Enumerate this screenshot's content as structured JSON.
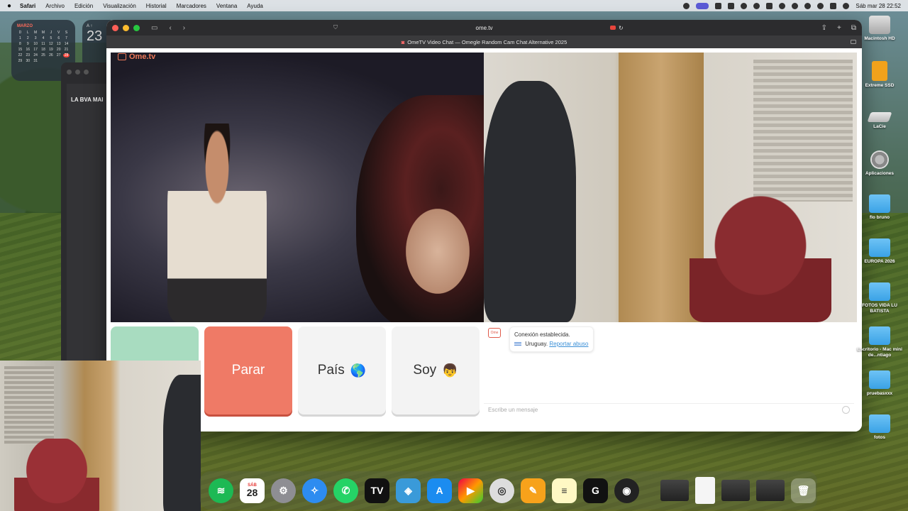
{
  "menubar": {
    "app": "Safari",
    "items": [
      "Archivo",
      "Edición",
      "Visualización",
      "Historial",
      "Marcadores",
      "Ventana",
      "Ayuda"
    ],
    "clock": "Sáb mar 28  22:52"
  },
  "calendar_widget": {
    "month": "MARZO",
    "weekdays": [
      "D",
      "L",
      "M",
      "M",
      "J",
      "V",
      "S"
    ],
    "days": [
      "1",
      "2",
      "3",
      "4",
      "5",
      "6",
      "7",
      "8",
      "9",
      "10",
      "11",
      "12",
      "13",
      "14",
      "15",
      "16",
      "17",
      "18",
      "19",
      "20",
      "21",
      "22",
      "23",
      "24",
      "25",
      "26",
      "27",
      "28",
      "29",
      "30",
      "31"
    ],
    "today": "28"
  },
  "clock_widget": {
    "top": "A ↑",
    "value": "23"
  },
  "bg_window": {
    "label": "LA BVA MAI"
  },
  "safari": {
    "url": "ome.tv",
    "tab_title": "OmeTV Video Chat — Omegle Random Cam Chat Alternative 2025"
  },
  "ometv": {
    "logo": "Ome.tv",
    "buttons": {
      "start": "",
      "stop": "Parar",
      "country": "País",
      "country_emoji": "🌎",
      "iam": "Soy",
      "iam_emoji": "👦"
    },
    "chat": {
      "status": "Conexión establecida.",
      "country": "Uruguay.",
      "report": "Reportar abuso",
      "placeholder": "Escribe un mensaje"
    }
  },
  "desktop_icons": [
    {
      "label": "Macintosh HD",
      "icon": "drive-icon"
    },
    {
      "label": "Extreme SSD",
      "icon": "external-drive-icon"
    },
    {
      "label": "LaCie",
      "icon": "drive-icon"
    },
    {
      "label": "Aplicaciones",
      "icon": "applications-icon"
    },
    {
      "label": "flo bruno",
      "icon": "folder-icon"
    },
    {
      "label": "EUROPA 2026",
      "icon": "folder-icon"
    },
    {
      "label": "FOTOS VIDA LU BATISTA",
      "icon": "folder-icon"
    },
    {
      "label": "Escritorio - Mac mini de...ntiago",
      "icon": "folder-icon"
    },
    {
      "label": "pruebasxxx",
      "icon": "folder-icon"
    },
    {
      "label": "fotos",
      "icon": "folder-icon"
    }
  ],
  "dock": {
    "calendar_dow": "SÁB",
    "calendar_day": "28",
    "apps": [
      "spotify-icon",
      "calendar-icon",
      "system-settings-icon",
      "safari-icon",
      "whatsapp-icon",
      "tradingview-icon",
      "preview-icon",
      "app-store-icon",
      "final-cut-icon",
      "logic-icon",
      "pages-icon",
      "notes-icon",
      "logitech-icon",
      "obs-icon"
    ]
  },
  "colors": {
    "stop": "#ef7a66",
    "start": "#a8dcc0",
    "brand": "#f07a5a",
    "link": "#3a8fd6"
  }
}
